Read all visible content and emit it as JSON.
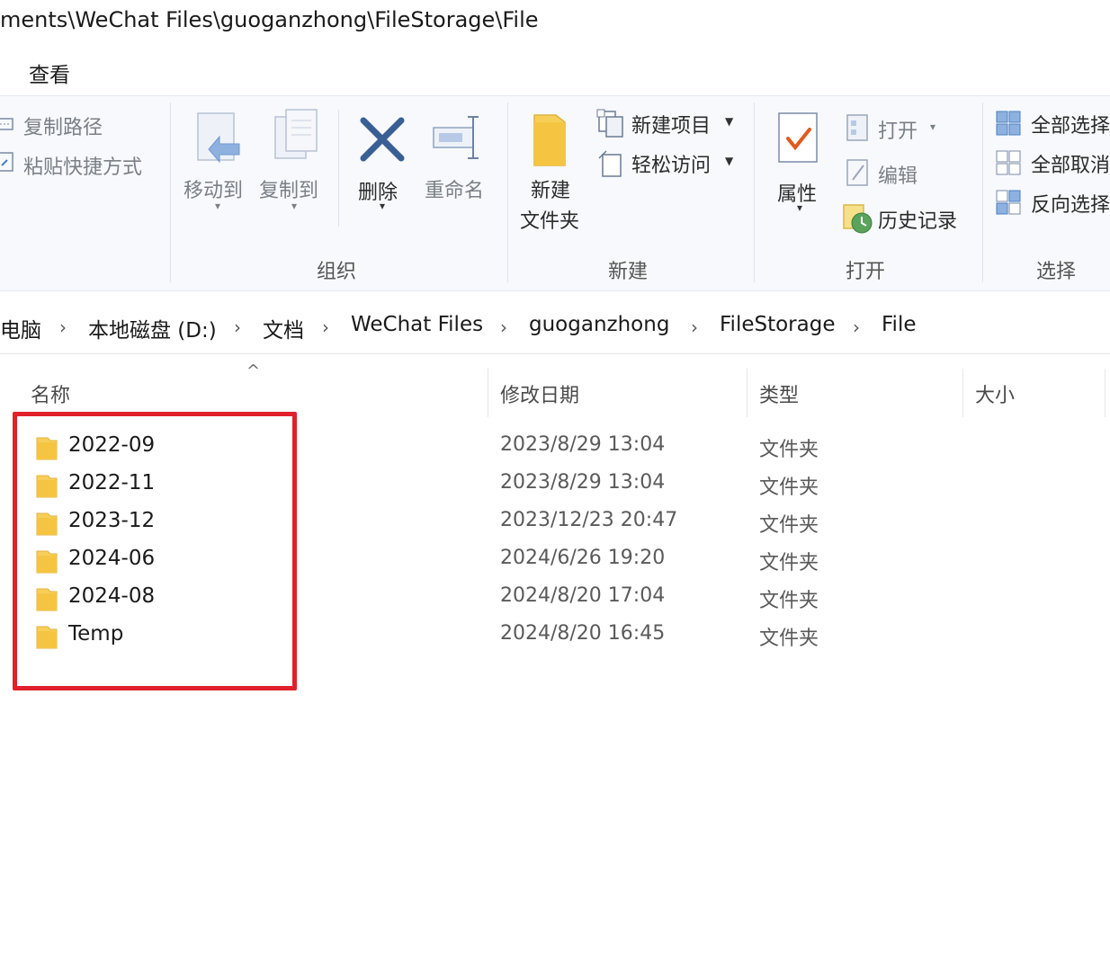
{
  "window": {
    "title": "ments\\WeChat Files\\guoganzhong\\FileStorage\\File"
  },
  "menu": {
    "view": "查看"
  },
  "ribbon": {
    "clipboard": {
      "copy_path": "复制路径",
      "paste_shortcut": "粘贴快捷方式"
    },
    "organize": {
      "move_to": "移动到",
      "copy_to": "复制到",
      "delete": "删除",
      "rename": "重命名",
      "label": "组织"
    },
    "new": {
      "new_item": "新建项目",
      "easy_access": "轻松访问",
      "new_folder_line1": "新建",
      "new_folder_line2": "文件夹",
      "label": "新建"
    },
    "open": {
      "properties": "属性",
      "open": "打开",
      "edit": "编辑",
      "history": "历史记录",
      "label": "打开"
    },
    "select": {
      "select_all": "全部选择",
      "select_none": "全部取消",
      "invert": "反向选择",
      "label": "选择"
    }
  },
  "address": {
    "crumbs": [
      "电脑",
      "本地磁盘 (D:)",
      "文档",
      "WeChat Files",
      "guoganzhong",
      "FileStorage",
      "File"
    ]
  },
  "columns": {
    "name": "名称",
    "date": "修改日期",
    "type": "类型",
    "size": "大小"
  },
  "files": [
    {
      "name": "2022-09",
      "date": "2023/8/29 13:04",
      "type": "文件夹"
    },
    {
      "name": "2022-11",
      "date": "2023/8/29 13:04",
      "type": "文件夹"
    },
    {
      "name": "2023-12",
      "date": "2023/12/23 20:47",
      "type": "文件夹"
    },
    {
      "name": "2024-06",
      "date": "2024/6/26 19:20",
      "type": "文件夹"
    },
    {
      "name": "2024-08",
      "date": "2024/8/20 17:04",
      "type": "文件夹"
    },
    {
      "name": "Temp",
      "date": "2024/8/20 16:45",
      "type": "文件夹"
    }
  ],
  "colors": {
    "highlight": "#e0202a",
    "folder": "#f5c542",
    "ribbon_bg": "#f7f9fc"
  }
}
